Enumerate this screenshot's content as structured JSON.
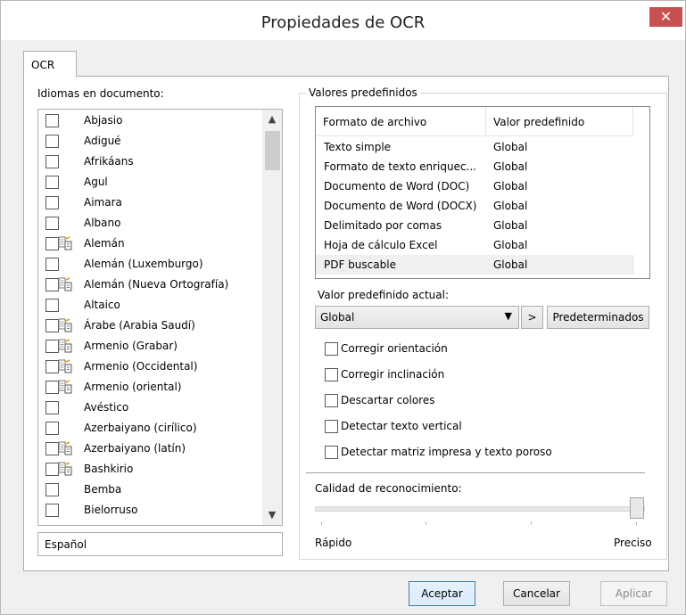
{
  "window": {
    "title": "Propiedades de OCR",
    "close_glyph": "✕"
  },
  "tabs": [
    {
      "label": "OCR"
    }
  ],
  "languages": {
    "label": "Idiomas en documento:",
    "items": [
      {
        "name": "Abjasio",
        "icon": false
      },
      {
        "name": "Adigué",
        "icon": false
      },
      {
        "name": "Afrikáans",
        "icon": false
      },
      {
        "name": "Agul",
        "icon": false
      },
      {
        "name": "Aimara",
        "icon": false
      },
      {
        "name": "Albano",
        "icon": false
      },
      {
        "name": "Alemán",
        "icon": true
      },
      {
        "name": "Alemán (Luxemburgo)",
        "icon": false
      },
      {
        "name": "Alemán (Nueva Ortografía)",
        "icon": true
      },
      {
        "name": "Altaico",
        "icon": false
      },
      {
        "name": "Árabe (Arabia Saudí)",
        "icon": true
      },
      {
        "name": "Armenio (Grabar)",
        "icon": true
      },
      {
        "name": "Armenio (Occidental)",
        "icon": true
      },
      {
        "name": "Armenio (oriental)",
        "icon": true
      },
      {
        "name": "Avéstico",
        "icon": false
      },
      {
        "name": "Azerbaiyano (cirílico)",
        "icon": false
      },
      {
        "name": "Azerbaiyano (latín)",
        "icon": true
      },
      {
        "name": "Bashkirio",
        "icon": true
      },
      {
        "name": "Bemba",
        "icon": false
      },
      {
        "name": "Bielorruso",
        "icon": false
      }
    ],
    "selected_field": "Español"
  },
  "presets": {
    "group_title": "Valores predefinidos",
    "columns": [
      "Formato de archivo",
      "Valor predefinido"
    ],
    "rows": [
      {
        "format": "Texto simple",
        "value": "Global"
      },
      {
        "format": "Formato de texto enriquec...",
        "value": "Global"
      },
      {
        "format": "Documento de Word (DOC)",
        "value": "Global"
      },
      {
        "format": "Documento de Word (DOCX)",
        "value": "Global"
      },
      {
        "format": "Delimitado por comas",
        "value": "Global"
      },
      {
        "format": "Hoja de cálculo Excel",
        "value": "Global"
      },
      {
        "format": "PDF buscable",
        "value": "Global"
      }
    ],
    "current_label": "Valor predefinido actual:",
    "current_value": "Global",
    "next_button": ">",
    "defaults_button": "Predeterminados"
  },
  "options": [
    {
      "label": "Corregir orientación",
      "checked": false
    },
    {
      "label": "Corregir inclinación",
      "checked": false
    },
    {
      "label": "Descartar colores",
      "checked": false
    },
    {
      "label": "Detectar texto vertical",
      "checked": false
    },
    {
      "label": "Detectar matriz impresa y texto poroso",
      "checked": false
    }
  ],
  "quality": {
    "label": "Calidad de reconocimiento:",
    "min_label": "Rápido",
    "max_label": "Preciso",
    "level": 1.0
  },
  "footer": {
    "accept": "Aceptar",
    "cancel": "Cancelar",
    "apply": "Aplicar"
  }
}
